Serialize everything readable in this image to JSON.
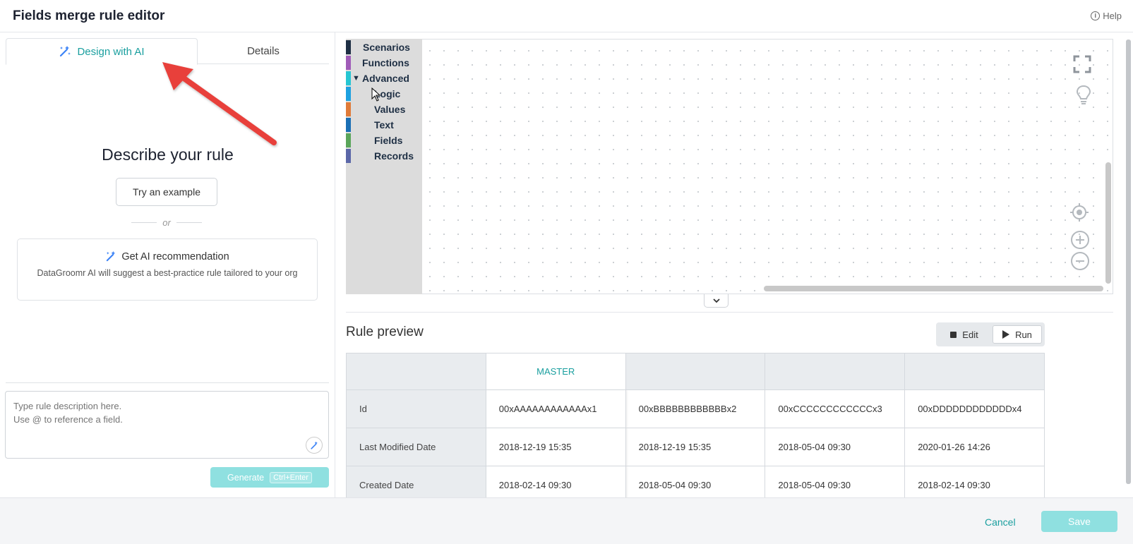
{
  "header": {
    "title": "Fields merge rule editor",
    "help_label": "Help"
  },
  "left": {
    "tabs": [
      {
        "label": "Design with AI",
        "active": true
      },
      {
        "label": "Details",
        "active": false
      }
    ],
    "heading": "Describe your rule",
    "try_example_label": "Try an example",
    "or_label": "or",
    "ai_card": {
      "title": "Get AI recommendation",
      "description": "DataGroomr AI will suggest a best-practice rule tailored to your org"
    },
    "prompt_placeholder": "Type rule description here.\nUse @ to reference a field.",
    "generate_label": "Generate",
    "generate_shortcut": "Ctrl+Enter"
  },
  "toolbox": {
    "categories": [
      {
        "label": "Scenarios",
        "color": "#1e2f44"
      },
      {
        "label": "Functions",
        "color": "#a05cb8"
      },
      {
        "label": "Advanced",
        "color": "#26c6d2",
        "expanded": true
      },
      {
        "label": "Logic",
        "color": "#1da1e0"
      },
      {
        "label": "Values",
        "color": "#e07b39"
      },
      {
        "label": "Text",
        "color": "#1a6fb5"
      },
      {
        "label": "Fields",
        "color": "#5aa55a"
      },
      {
        "label": "Records",
        "color": "#5b67a8"
      }
    ],
    "workspace_icons": [
      "fullscreen-icon",
      "lightbulb-icon",
      "recenter-icon",
      "zoom-in-icon",
      "zoom-out-icon"
    ]
  },
  "preview": {
    "title": "Rule preview",
    "edit_label": "Edit",
    "run_label": "Run",
    "columns": [
      "",
      "MASTER",
      "",
      "",
      ""
    ],
    "rows": [
      {
        "label": "Id",
        "values": [
          "00xAAAAAAAAAAAAx1",
          "00xBBBBBBBBBBBBx2",
          "00xCCCCCCCCCCCCx3",
          "00xDDDDDDDDDDDDx4"
        ]
      },
      {
        "label": "Last Modified Date",
        "values": [
          "2018-12-19 15:35",
          "2018-12-19 15:35",
          "2018-05-04 09:30",
          "2020-01-26 14:26"
        ]
      },
      {
        "label": "Created Date",
        "values": [
          "2018-02-14 09:30",
          "2018-05-04 09:30",
          "2018-05-04 09:30",
          "2018-02-14 09:30"
        ]
      }
    ]
  },
  "footer": {
    "cancel_label": "Cancel",
    "save_label": "Save"
  },
  "colors": {
    "accent": "#1a9f9f",
    "accent_disabled": "#8fe0e0",
    "arrow": "#e8413b"
  }
}
